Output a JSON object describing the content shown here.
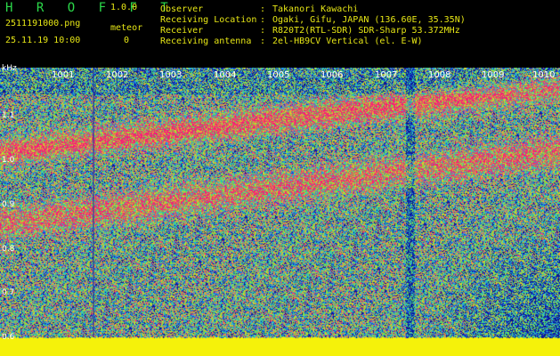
{
  "app": {
    "title": "H R O F F T",
    "version": "1.0.0"
  },
  "file": {
    "name": "2511191000.png",
    "datetime": "25.11.19 10:00"
  },
  "meteor": {
    "label": "meteor",
    "count": "0"
  },
  "info": [
    {
      "label": "Observer",
      "value": "Takanori Kawachi"
    },
    {
      "label": "Receiving Location",
      "value": "Ogaki, Gifu, JAPAN (136.60E, 35.35N)"
    },
    {
      "label": "Receiver",
      "value": "R820T2(RTL-SDR) SDR-Sharp 53.372MHz"
    },
    {
      "label": "Receiving antenna",
      "value": "2el-HB9CV Vertical (el. E-W)"
    }
  ],
  "colon": ":",
  "y_axis": {
    "unit": "kHz",
    "ticks": [
      "1.1",
      "1.0",
      "0.9",
      "0.8",
      "0.7",
      "0.6"
    ]
  },
  "x_axis": {
    "ticks": [
      "1001",
      "1002",
      "1003",
      "1004",
      "1005",
      "1006",
      "1007",
      "1008",
      "1009",
      "1010"
    ]
  },
  "colors": {
    "title": "#2bd94a",
    "text": "#e6e615",
    "baseline": "#f2f20a"
  }
}
